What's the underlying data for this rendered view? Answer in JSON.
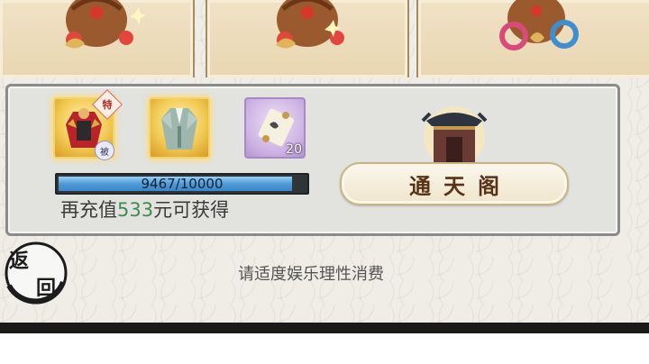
{
  "rewards_top": [
    {
      "icon": "lucky-bag-icon"
    },
    {
      "icon": "lucky-bag-icon"
    },
    {
      "icon": "lucky-bag-jade-icon"
    }
  ],
  "panel": {
    "items": [
      {
        "icon": "armor-skin-icon",
        "badge_top": "特",
        "badge_bottom": "被"
      },
      {
        "icon": "robe-skin-icon"
      },
      {
        "icon": "scroll-icon",
        "count": "20"
      }
    ],
    "progress": {
      "text": "9467/10000",
      "current": 9467,
      "max": 10000
    },
    "recharge": {
      "prefix": "再充值",
      "amount": "533",
      "suffix": "元可获得"
    },
    "tower_button": {
      "label": "通天阁"
    }
  },
  "back_button": {
    "line1": "返",
    "line2": "回"
  },
  "notice": "请适度娱乐理性消费",
  "colors": {
    "accent_green": "#3f8c4e",
    "progress_blue": "#4e9bd8",
    "button_text": "#5a3218"
  }
}
